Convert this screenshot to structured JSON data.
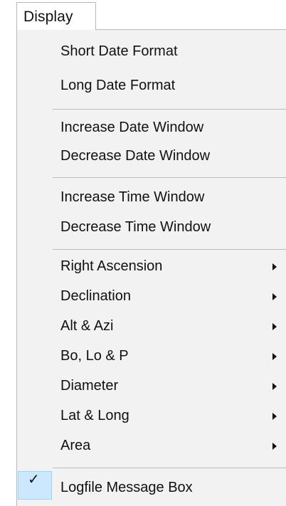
{
  "menu": {
    "title": "Display",
    "groups": [
      {
        "items": [
          {
            "label": "Short Date Format",
            "submenu": false
          },
          {
            "label": "Long Date Format",
            "submenu": false
          }
        ]
      },
      {
        "items": [
          {
            "label": "Increase Date Window",
            "submenu": false
          },
          {
            "label": "Decrease Date Window",
            "submenu": false
          }
        ]
      },
      {
        "items": [
          {
            "label": "Increase Time Window",
            "submenu": false
          },
          {
            "label": "Decrease Time Window",
            "submenu": false
          }
        ]
      },
      {
        "items": [
          {
            "label": "Right Ascension",
            "submenu": true
          },
          {
            "label": "Declination",
            "submenu": true
          },
          {
            "label": "Alt & Azi",
            "submenu": true
          },
          {
            "label": "Bo, Lo & P",
            "submenu": true
          },
          {
            "label": "Diameter",
            "submenu": true
          },
          {
            "label": "Lat & Long",
            "submenu": true
          },
          {
            "label": "Area",
            "submenu": true
          }
        ]
      },
      {
        "items": [
          {
            "label": "Logfile Message Box",
            "submenu": false,
            "checked": true,
            "check_glyph": "✓"
          }
        ]
      }
    ]
  }
}
